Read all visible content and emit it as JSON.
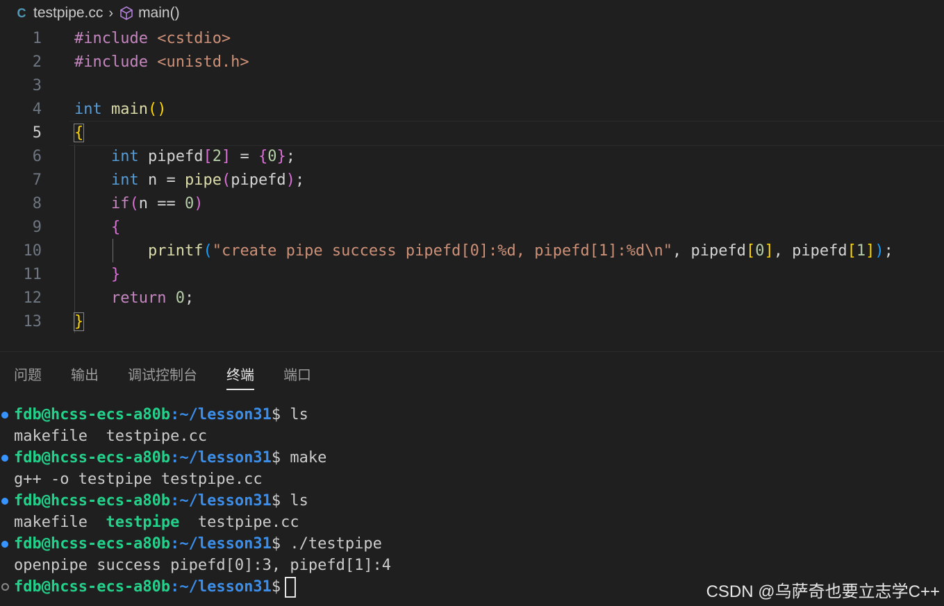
{
  "breadcrumb": {
    "file": "testpipe.cc",
    "file_icon": "C++",
    "symbol": "main()"
  },
  "editor": {
    "lines": [
      {
        "n": "1"
      },
      {
        "n": "2"
      },
      {
        "n": "3"
      },
      {
        "n": "4"
      },
      {
        "n": "5"
      },
      {
        "n": "6"
      },
      {
        "n": "7"
      },
      {
        "n": "8"
      },
      {
        "n": "9"
      },
      {
        "n": "10"
      },
      {
        "n": "11"
      },
      {
        "n": "12"
      },
      {
        "n": "13"
      }
    ],
    "tokens": {
      "l1_a": "#include ",
      "l1_b": "<cstdio>",
      "l2_a": "#include ",
      "l2_b": "<unistd.h>",
      "l4_kw": "int",
      "l4_fn": " main",
      "l4_br": "()",
      "l5_br": "{",
      "l6_kw": "int",
      "l6_a": " pipefd",
      "l6_b1": "[",
      "l6_num": "2",
      "l6_b2": "]",
      "l6_c": " = ",
      "l6_b3": "{",
      "l6_num2": "0",
      "l6_b4": "}",
      "l6_d": ";",
      "l7_kw": "int",
      "l7_a": " n = ",
      "l7_fn": "pipe",
      "l7_b1": "(",
      "l7_c": "pipefd",
      "l7_b2": ")",
      "l7_d": ";",
      "l8_kw": "if",
      "l8_b1": "(",
      "l8_a": "n == ",
      "l8_num": "0",
      "l8_b2": ")",
      "l9_br": "{",
      "l10_fn": "printf",
      "l10_b1": "(",
      "l10_str": "\"create pipe success pipefd[0]:%d, pipefd[1]:%d\\n\"",
      "l10_a": ", pipefd",
      "l10_b2": "[",
      "l10_n1": "0",
      "l10_b3": "]",
      "l10_c": ", pipefd",
      "l10_b4": "[",
      "l10_n2": "1",
      "l10_b5": "]",
      "l10_b6": ")",
      "l10_d": ";",
      "l11_br": "}",
      "l12_kw": "return",
      "l12_num": " 0",
      "l12_d": ";",
      "l13_br": "}"
    }
  },
  "panel": {
    "tabs": [
      "问题",
      "输出",
      "调试控制台",
      "终端",
      "端口"
    ],
    "active_tab": "终端"
  },
  "terminal": {
    "user": "fdb@hcss-ecs-a80b",
    "path": ":~/lesson31",
    "lines": [
      {
        "type": "prompt",
        "cmd": " ls"
      },
      {
        "type": "out",
        "text": "makefile  testpipe.cc"
      },
      {
        "type": "prompt",
        "cmd": " make"
      },
      {
        "type": "out",
        "text": "g++ -o testpipe testpipe.cc"
      },
      {
        "type": "prompt",
        "cmd": " ls"
      },
      {
        "type": "ls",
        "a": "makefile  ",
        "exe": "testpipe",
        "b": "  testpipe.cc"
      },
      {
        "type": "prompt",
        "cmd": " ./testpipe"
      },
      {
        "type": "out",
        "text": "openpipe success pipefd[0]:3, pipefd[1]:4"
      },
      {
        "type": "prompt",
        "cmd": ""
      }
    ],
    "dollar": "$"
  },
  "watermark": "CSDN @乌萨奇也要立志学C++",
  "colors": {
    "background": "#1f1f1f",
    "prompt_user": "#23d18b",
    "prompt_path": "#3b8eea"
  }
}
